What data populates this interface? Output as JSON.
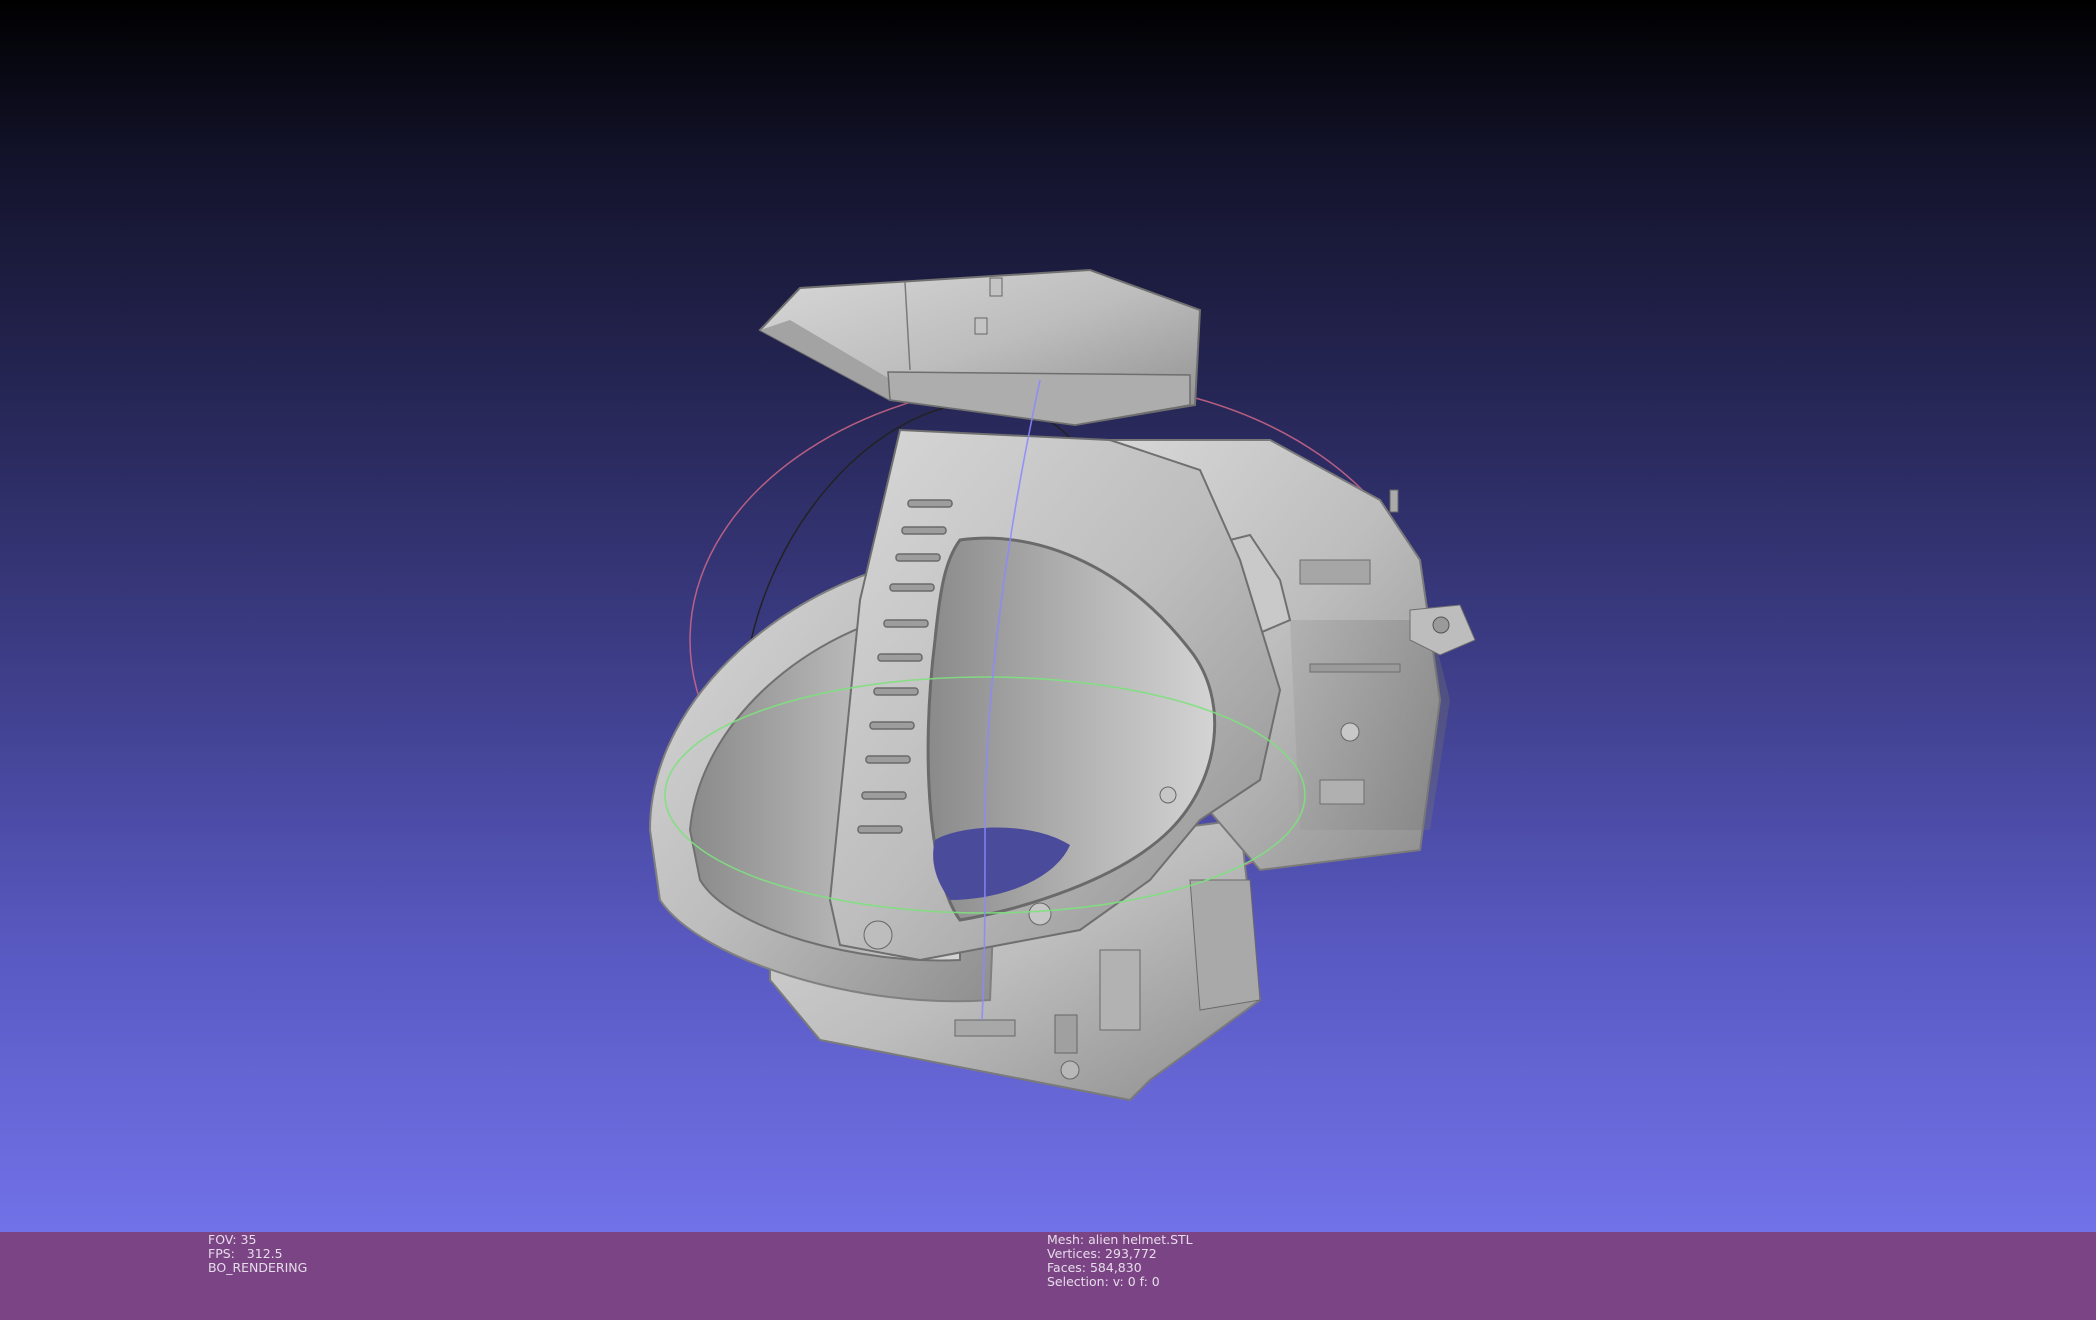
{
  "render_info": {
    "fov": "FOV: 35",
    "fps": "FPS:   312.5",
    "mode": "BO_RENDERING"
  },
  "mesh_info": {
    "mesh": "Mesh: alien helmet.STL",
    "vertices": "Vertices: 293,772",
    "faces": "Faces: 584,830",
    "selection": "Selection: v: 0 f: 0"
  },
  "colors": {
    "status_bar": "#7b4585",
    "mesh_fill": "#c2c2c2",
    "trackball_red": "#d86b8a",
    "trackball_green": "#7ee07e",
    "trackball_blue": "#8a8aff"
  }
}
